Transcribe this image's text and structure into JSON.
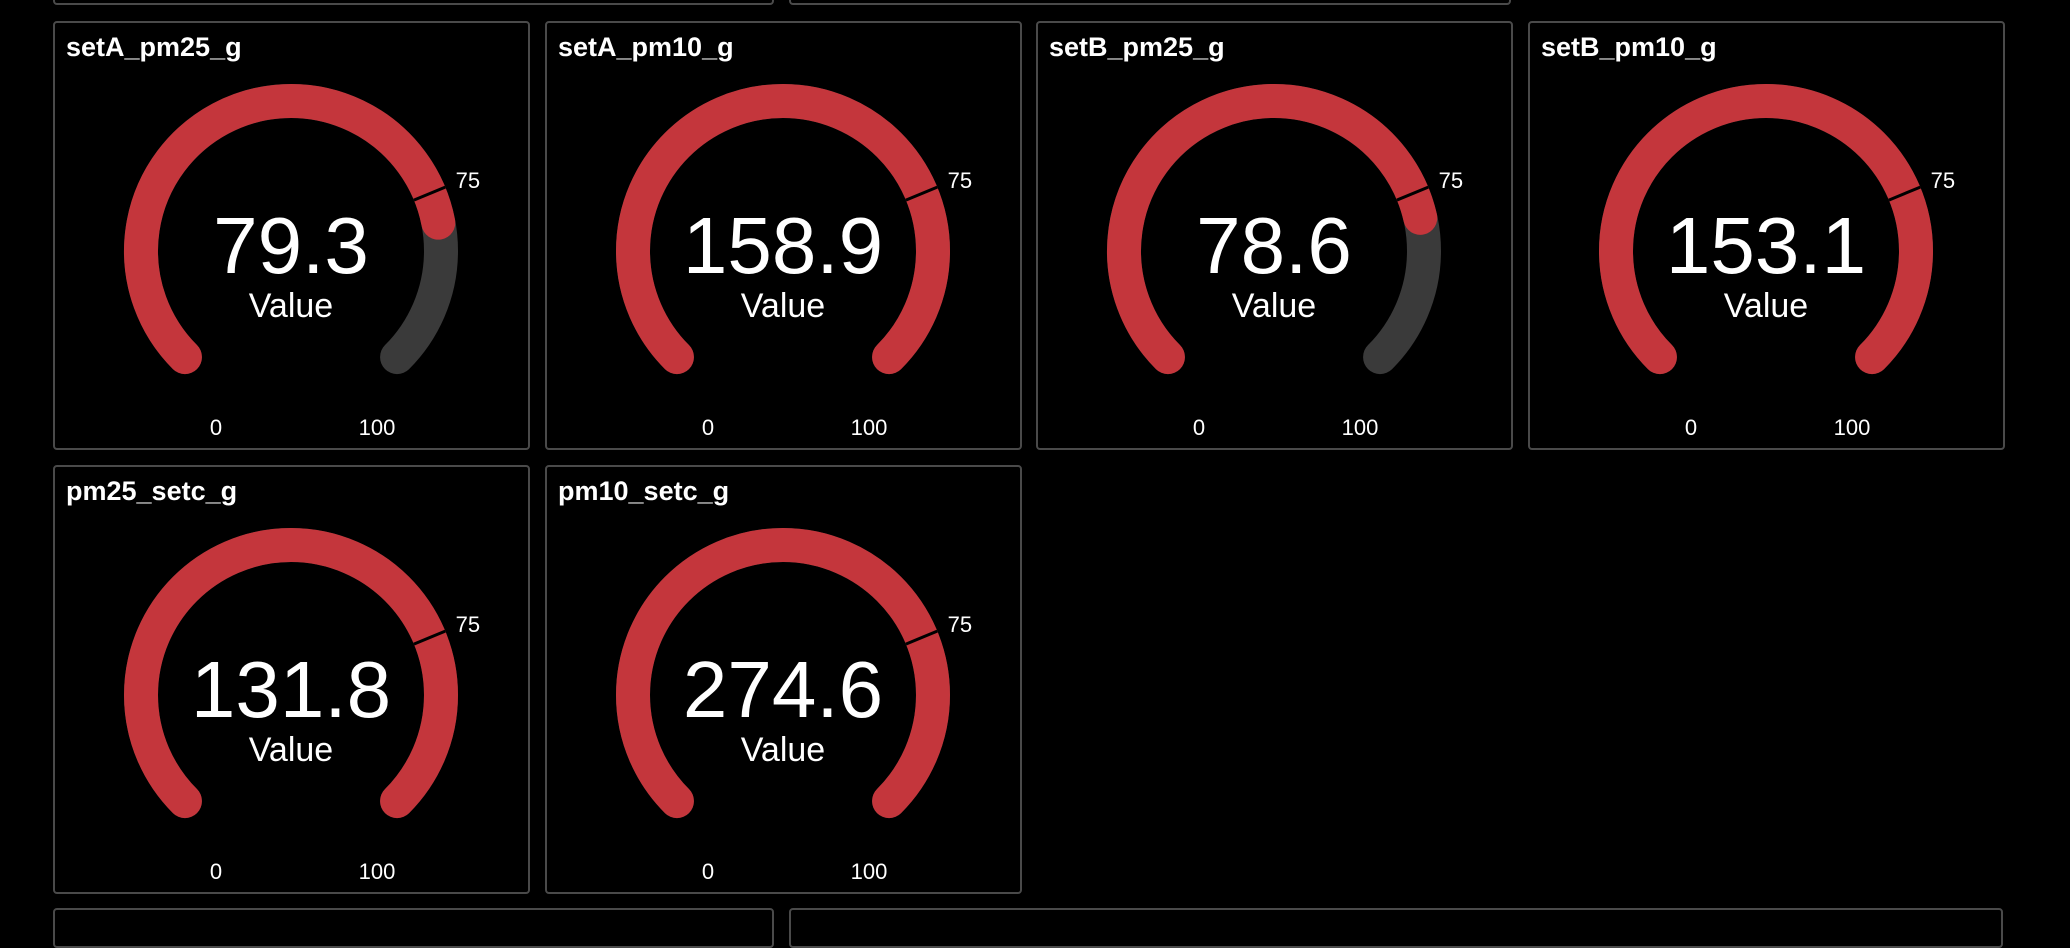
{
  "gauge_settings": {
    "min": 0,
    "max": 100,
    "threshold": 75,
    "min_label": "0",
    "max_label": "100",
    "threshold_label": "75",
    "value_label": "Value",
    "colors": {
      "fill": "#c4363c",
      "track": "#3a3a3a",
      "background": "#000000",
      "border": "#4a4a4a",
      "text": "#ffffff"
    }
  },
  "gauges": [
    {
      "title": "setA_pm25_g",
      "value": 79.3,
      "display": "79.3"
    },
    {
      "title": "setA_pm10_g",
      "value": 158.9,
      "display": "158.9"
    },
    {
      "title": "setB_pm25_g",
      "value": 78.6,
      "display": "78.6"
    },
    {
      "title": "setB_pm10_g",
      "value": 153.1,
      "display": "153.1"
    },
    {
      "title": "pm25_setc_g",
      "value": 131.8,
      "display": "131.8"
    },
    {
      "title": "pm10_setc_g",
      "value": 274.6,
      "display": "274.6"
    }
  ]
}
